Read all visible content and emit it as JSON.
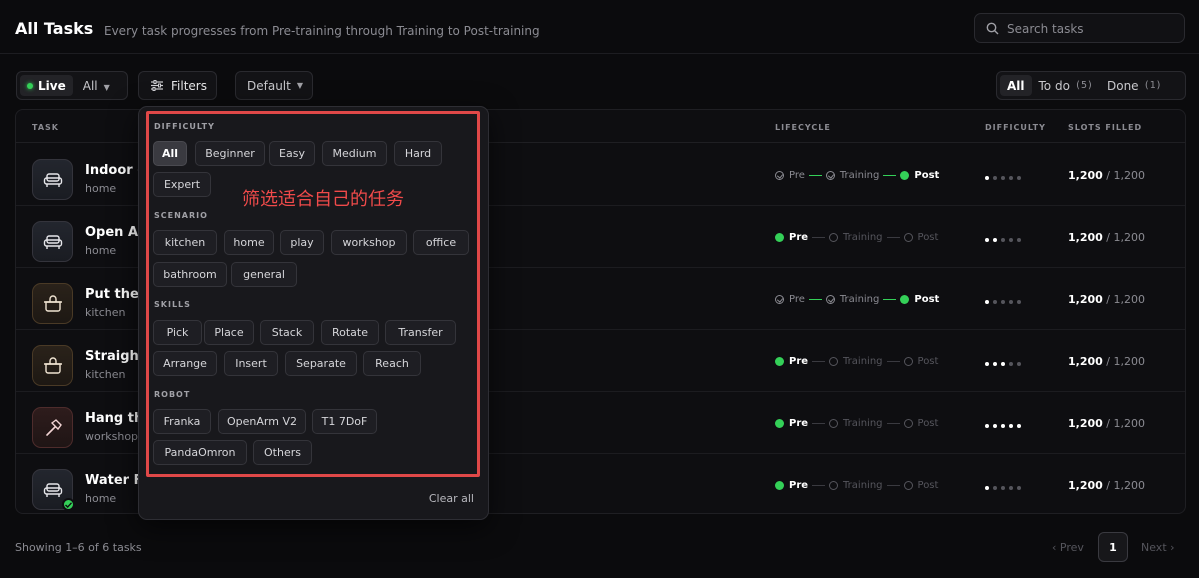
{
  "header": {
    "title": "All Tasks",
    "subtitle": "Every task progresses from Pre-training through Training to Post-training",
    "search_placeholder": "Search tasks"
  },
  "toolbar": {
    "live_label": "Live",
    "all_label": "All",
    "filters_label": "Filters",
    "sort_label": "Default",
    "tabs": [
      {
        "label": "All",
        "count": ""
      },
      {
        "label": "To do",
        "count": "(5)"
      },
      {
        "label": "Done",
        "count": "(1)"
      }
    ]
  },
  "table": {
    "columns": [
      "TASK",
      "LIFECYCLE",
      "DIFFICULTY",
      "SLOTS FILLED"
    ],
    "rows": [
      {
        "name": "Indoor -",
        "scene": "home",
        "icon": "sofa-icon",
        "lifecycle": [
          "done",
          "done",
          "current"
        ],
        "difficulty": 1,
        "filled": "1,200",
        "total": "/ 1,200"
      },
      {
        "name": "Open Arr",
        "scene": "home",
        "icon": "sofa-icon",
        "lifecycle": [
          "current",
          "pending",
          "pending"
        ],
        "difficulty": 2,
        "filled": "1,200",
        "total": "/ 1,200"
      },
      {
        "name": "Put the S",
        "scene": "kitchen",
        "icon": "pot-icon",
        "lifecycle": [
          "done",
          "done",
          "current"
        ],
        "difficulty": 1,
        "filled": "1,200",
        "total": "/ 1,200"
      },
      {
        "name": "Straight",
        "scene": "kitchen",
        "icon": "pot-icon",
        "lifecycle": [
          "current",
          "pending",
          "pending"
        ],
        "difficulty": 3,
        "filled": "1,200",
        "total": "/ 1,200"
      },
      {
        "name": "Hang the",
        "scene": "workshop",
        "icon": "hammer-icon",
        "lifecycle": [
          "current",
          "pending",
          "pending"
        ],
        "difficulty": 5,
        "filled": "1,200",
        "total": "/ 1,200"
      },
      {
        "name": "Water Flo",
        "scene": "home",
        "icon": "sofa-icon",
        "lifecycle": [
          "current",
          "pending",
          "pending"
        ],
        "difficulty": 1,
        "filled": "1,200",
        "total": "/ 1,200"
      }
    ],
    "stage_labels": [
      "Pre",
      "Training",
      "Post"
    ]
  },
  "filters": {
    "sections": [
      {
        "title": "DIFFICULTY",
        "chips": [
          "All",
          "Beginner",
          "Easy",
          "Medium",
          "Hard",
          "Expert"
        ],
        "active": "All"
      },
      {
        "title": "SCENARIO",
        "chips": [
          "kitchen",
          "home",
          "play",
          "workshop",
          "office",
          "bathroom",
          "general"
        ]
      },
      {
        "title": "SKILLS",
        "chips": [
          "Pick",
          "Place",
          "Stack",
          "Rotate",
          "Transfer",
          "Arrange",
          "Insert",
          "Separate",
          "Reach"
        ]
      },
      {
        "title": "ROBOT",
        "chips": [
          "Franka",
          "OpenArm V2",
          "T1 7DoF",
          "PandaOmron",
          "Others"
        ]
      }
    ],
    "annotation": "筛选适合自己的任务",
    "clear_label": "Clear all"
  },
  "footer": {
    "showing": "Showing 1–6 of 6 tasks",
    "prev": "‹ Prev",
    "page": "1",
    "next": "Next ›"
  },
  "colors": {
    "accent_green": "#34d058",
    "annotation_red": "#e04848"
  }
}
